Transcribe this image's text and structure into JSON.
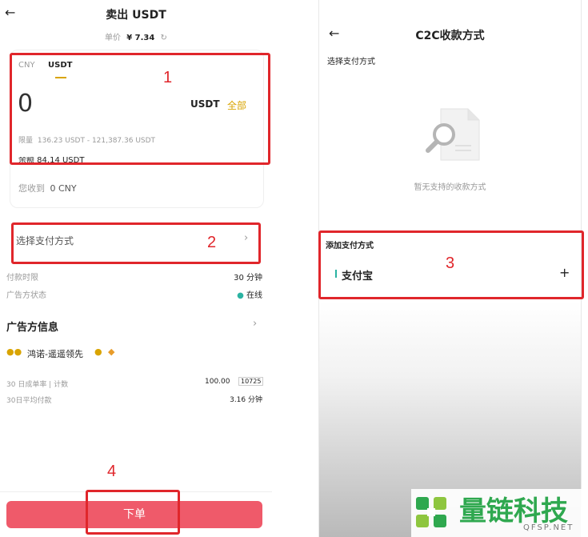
{
  "left": {
    "back_icon": "back-arrow-icon",
    "title": "卖出 USDT",
    "unit_price_label": "单价",
    "unit_price_value": "¥ 7.34",
    "refresh_icon": "refresh-icon",
    "tabs": [
      "CNY",
      "USDT"
    ],
    "amount": "0",
    "currency": "USDT",
    "all_label": "全部",
    "limit_label": "限量",
    "limit_value": "136.23 USDT - 121,387.36 USDT",
    "balance_partial": "余额  84.14  USDT",
    "receive_label": "您收到",
    "receive_value": "0 CNY",
    "payment_method_label": "选择支付方式",
    "payment_time_label": "付款时限",
    "payment_time_value": "30 分钟",
    "advertiser_status_label": "广告方状态",
    "advertiser_status_value": "在线",
    "advertiser_info_label": "广告方信息",
    "advertiser_name": "鸿诺-遥遥领先",
    "stats_rate_label": "30 日成单率 | 计数",
    "stats_rate_value": "100.00",
    "stats_count": "10725",
    "stats_avg_label": "30日平均付款",
    "stats_avg_value": "3.16 分钟",
    "order_button": "下单"
  },
  "right": {
    "title": "C2C收款方式",
    "select_label": "选择支付方式",
    "empty_text": "暂无支持的收款方式",
    "add_label": "添加支付方式",
    "alipay_label": "支付宝",
    "plus": "+"
  },
  "markers": [
    "1",
    "2",
    "3",
    "4"
  ],
  "watermark": {
    "brand": "量链科技",
    "domain": "QFSP.NET"
  },
  "colors": {
    "marker_red": "#e0262b",
    "accent_gold": "#d9a400",
    "order_pink": "#ef5a6a",
    "online_teal": "#2bb3a2",
    "logo_green": "#2fa84f"
  }
}
